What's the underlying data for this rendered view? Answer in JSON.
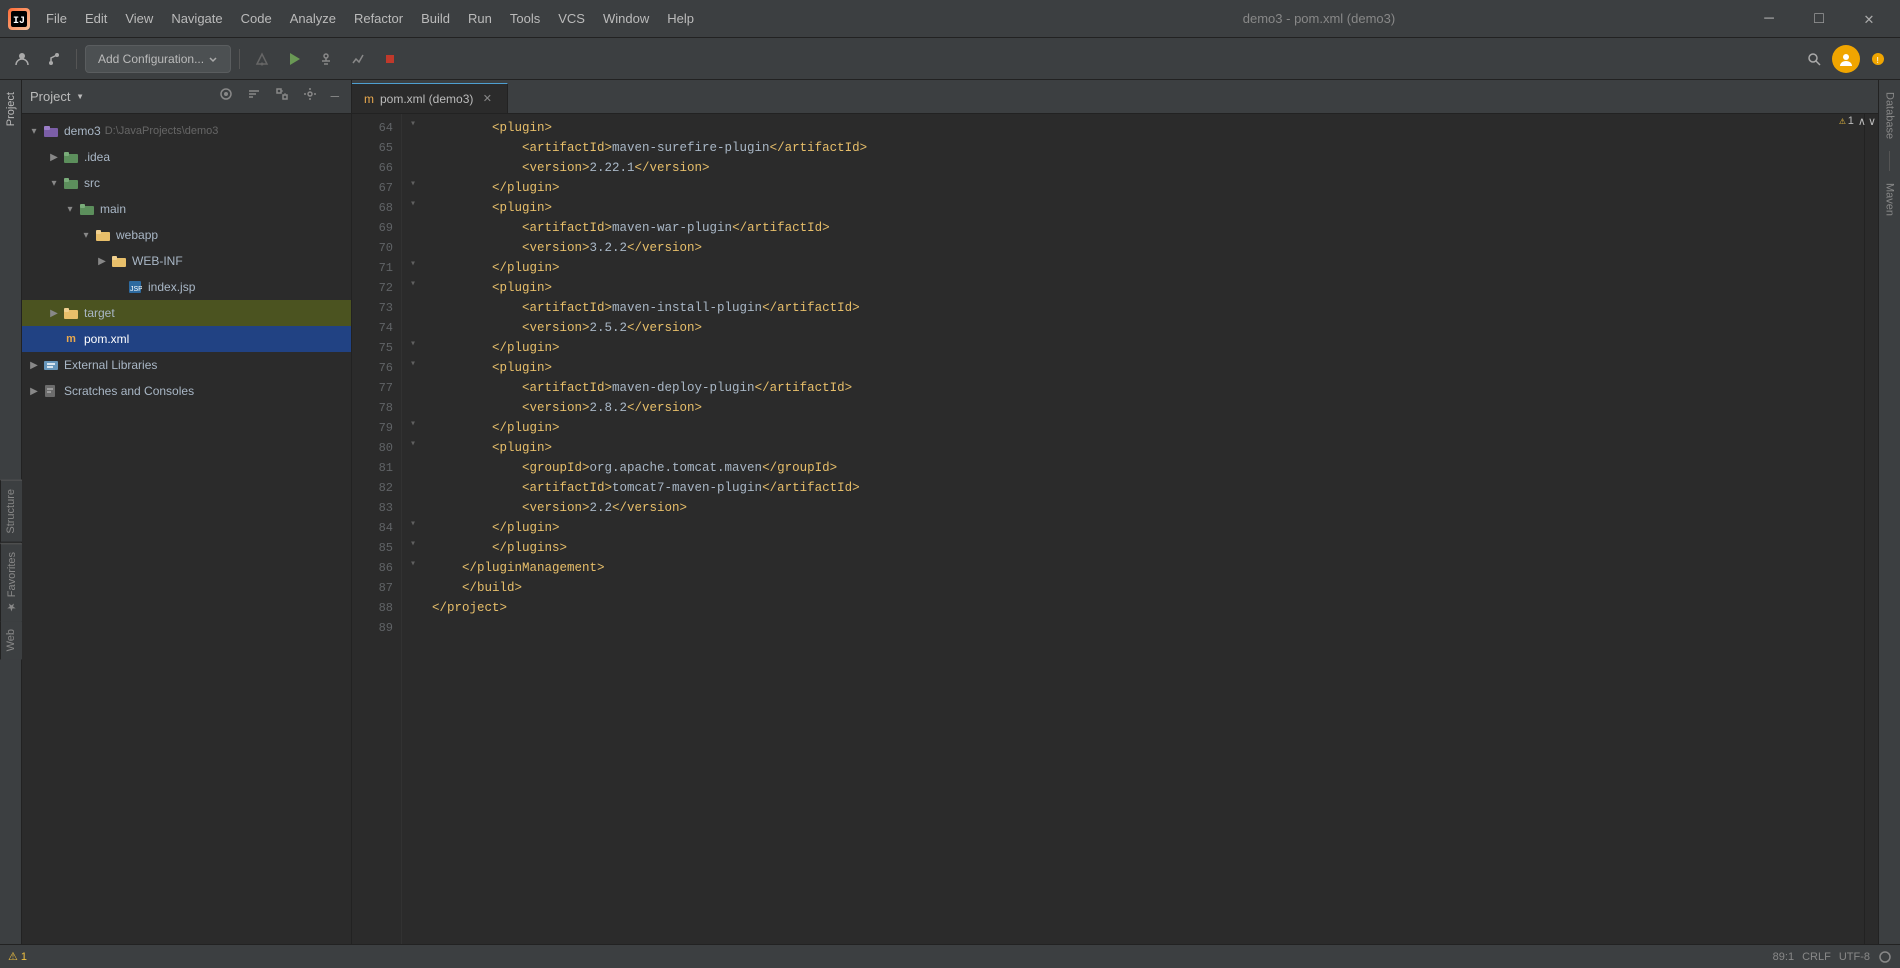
{
  "titlebar": {
    "logo": "IJ",
    "project": "demo3",
    "file": "pom.xml (demo3)",
    "menus": [
      "File",
      "Edit",
      "View",
      "Navigate",
      "Code",
      "Analyze",
      "Refactor",
      "Build",
      "Run",
      "Tools",
      "VCS",
      "Window",
      "Help"
    ],
    "title": "demo3 - pom.xml (demo3)",
    "minimize": "─",
    "maximize": "□",
    "close": "✕"
  },
  "toolbar": {
    "add_config_label": "Add Configuration...",
    "account_icon": "👤",
    "bookmark_icon": "🔖"
  },
  "project_panel": {
    "title": "Project",
    "dropdown": "▾",
    "root": "demo3",
    "root_path": "D:\\JavaProjects\\demo3",
    "items": [
      {
        "label": ".idea",
        "type": "folder",
        "indent": 1,
        "collapsed": true
      },
      {
        "label": "src",
        "type": "folder",
        "indent": 1,
        "collapsed": false
      },
      {
        "label": "main",
        "type": "folder",
        "indent": 2,
        "collapsed": false
      },
      {
        "label": "webapp",
        "type": "folder",
        "indent": 3,
        "collapsed": false
      },
      {
        "label": "WEB-INF",
        "type": "folder",
        "indent": 4,
        "collapsed": true
      },
      {
        "label": "index.jsp",
        "type": "jsp",
        "indent": 4
      },
      {
        "label": "target",
        "type": "folder",
        "indent": 1,
        "collapsed": true,
        "highlighted": true
      },
      {
        "label": "pom.xml",
        "type": "xml",
        "indent": 1,
        "selected": true
      },
      {
        "label": "External Libraries",
        "type": "lib",
        "indent": 0,
        "collapsed": true
      },
      {
        "label": "Scratches and Consoles",
        "type": "scratch",
        "indent": 0,
        "collapsed": true
      }
    ]
  },
  "editor": {
    "tab_label": "pom.xml (demo3)",
    "tab_icon": "m",
    "lines": [
      {
        "num": 64,
        "content": "        <plugin>",
        "fold": true
      },
      {
        "num": 65,
        "content": "            <artifactId>maven-surefire-plugin</artifactId>"
      },
      {
        "num": 66,
        "content": "            <version>2.22.1</version>"
      },
      {
        "num": 67,
        "content": "        </plugin>",
        "fold": true
      },
      {
        "num": 68,
        "content": "        <plugin>",
        "fold": true
      },
      {
        "num": 69,
        "content": "            <artifactId>maven-war-plugin</artifactId>"
      },
      {
        "num": 70,
        "content": "            <version>3.2.2</version>"
      },
      {
        "num": 71,
        "content": "        </plugin>",
        "fold": true
      },
      {
        "num": 72,
        "content": "        <plugin>",
        "fold": true
      },
      {
        "num": 73,
        "content": "            <artifactId>maven-install-plugin</artifactId>"
      },
      {
        "num": 74,
        "content": "            <version>2.5.2</version>"
      },
      {
        "num": 75,
        "content": "        </plugin>",
        "fold": true
      },
      {
        "num": 76,
        "content": "        <plugin>",
        "fold": true
      },
      {
        "num": 77,
        "content": "            <artifactId>maven-deploy-plugin</artifactId>"
      },
      {
        "num": 78,
        "content": "            <version>2.8.2</version>"
      },
      {
        "num": 79,
        "content": "        </plugin>",
        "fold": true
      },
      {
        "num": 80,
        "content": "        <plugin>",
        "fold": true
      },
      {
        "num": 81,
        "content": "            <groupId>org.apache.tomcat.maven</groupId>"
      },
      {
        "num": 82,
        "content": "            <artifactId>tomcat7-maven-plugin</artifactId>"
      },
      {
        "num": 83,
        "content": "            <version>2.2</version>"
      },
      {
        "num": 84,
        "content": "        </plugin>",
        "fold": true
      },
      {
        "num": 85,
        "content": "        </plugins>",
        "fold": true
      },
      {
        "num": 86,
        "content": "    </pluginManagement>",
        "fold": true
      },
      {
        "num": 87,
        "content": "    </build>",
        "fold": false
      },
      {
        "num": 88,
        "content": "</project>",
        "fold": false
      },
      {
        "num": 89,
        "content": ""
      }
    ]
  },
  "statusbar": {
    "warning_count": "⚠ 1",
    "encoding": "UTF-8",
    "line_sep": "CRLF",
    "position": "89:1"
  },
  "right_sidebar": {
    "database_label": "Database",
    "maven_label": "Maven"
  },
  "left_tabs": {
    "structure_label": "Structure",
    "favorites_label": "Favorites",
    "web_label": "Web"
  }
}
